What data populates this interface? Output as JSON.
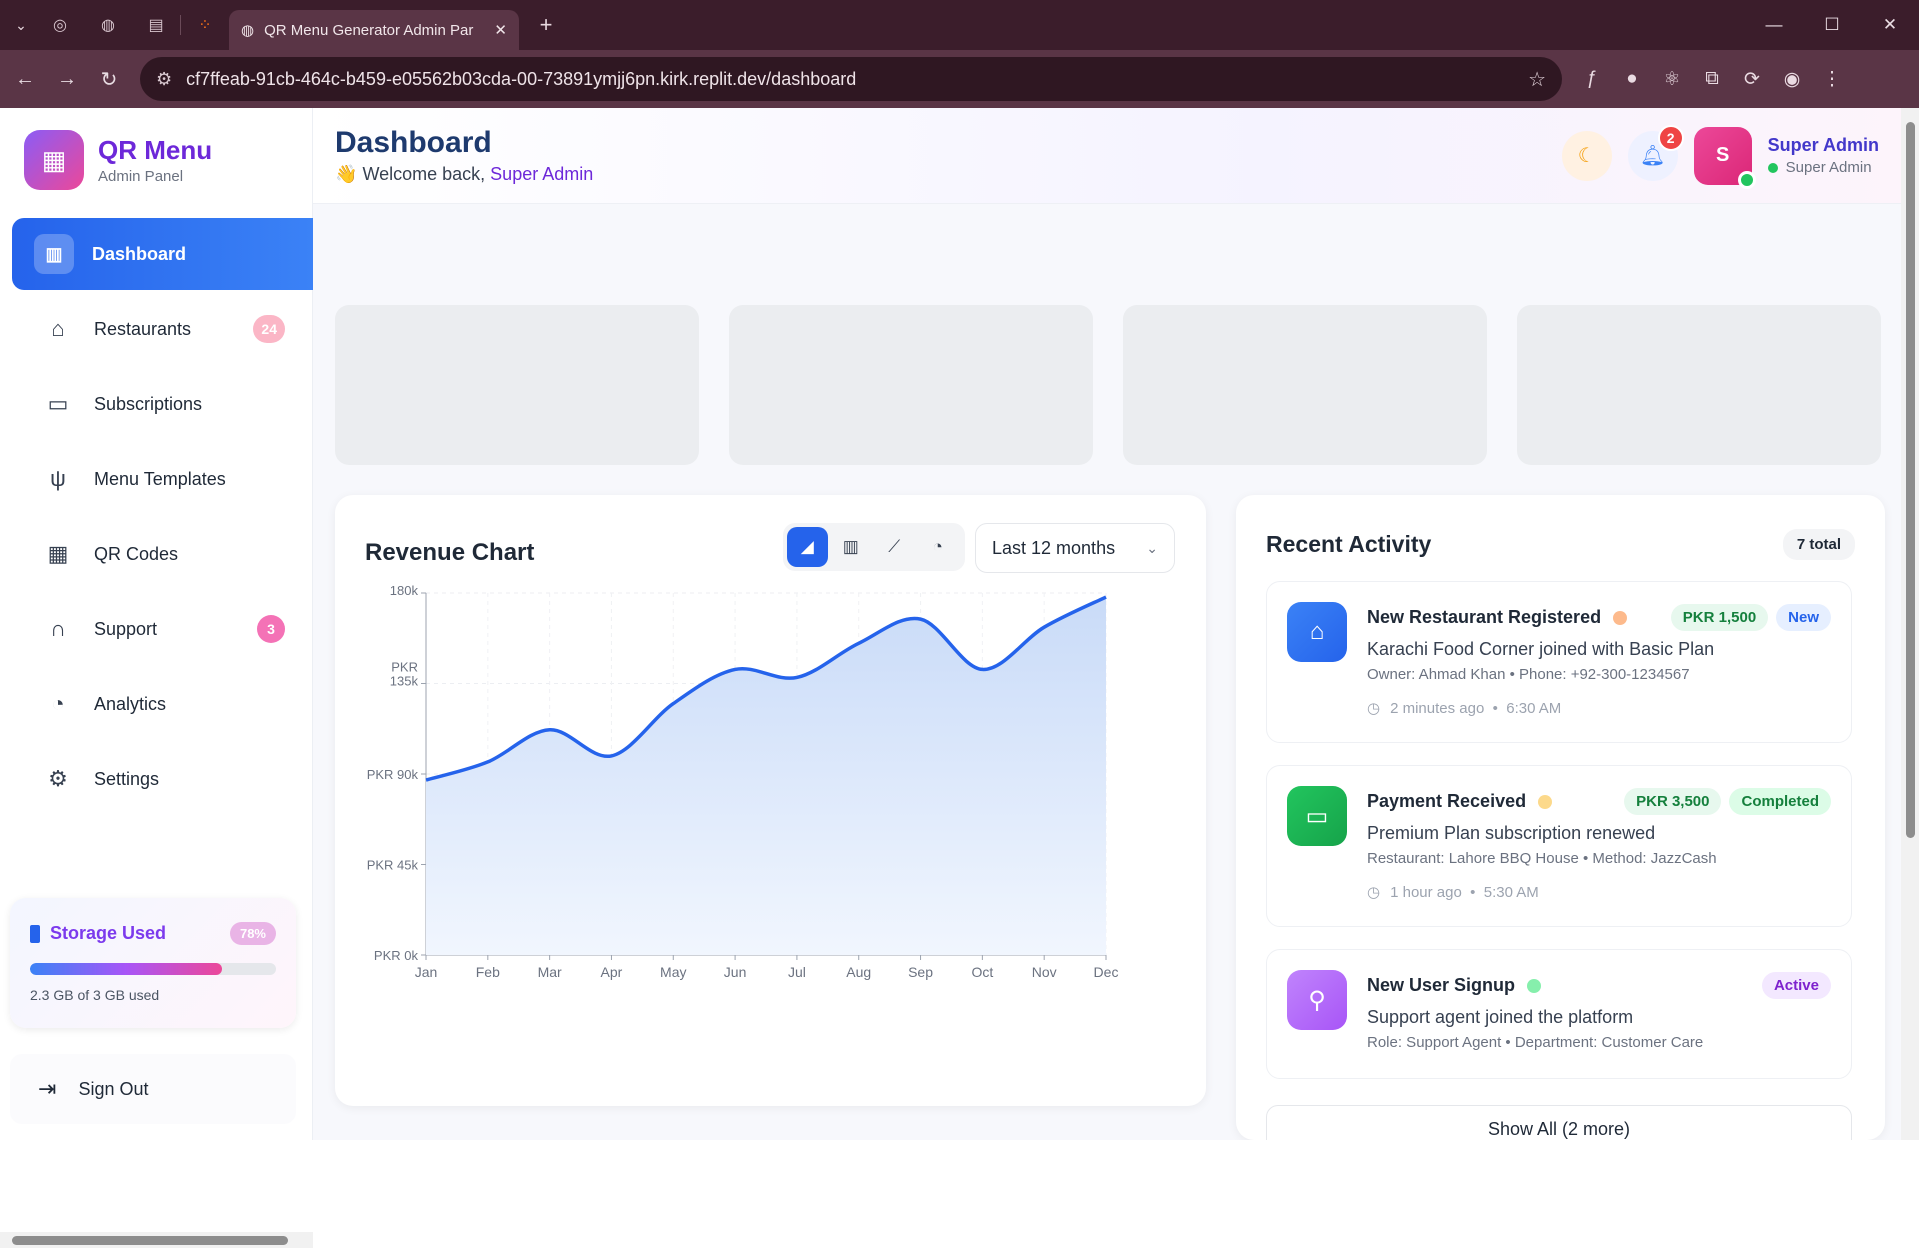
{
  "browser": {
    "tab_title": "QR Menu Generator Admin Par",
    "url": "cf7ffeab-91cb-464c-b459-e05562b03cda-00-73891ymjj6pn.kirk.replit.dev/dashboard"
  },
  "sidebar": {
    "brand_name": "QR Menu",
    "brand_sub": "Admin Panel",
    "items": [
      {
        "label": "Dashboard",
        "icon": "chart-icon",
        "active": true
      },
      {
        "label": "Restaurants",
        "icon": "store-icon",
        "badge": "24"
      },
      {
        "label": "Subscriptions",
        "icon": "card-icon"
      },
      {
        "label": "Menu Templates",
        "icon": "utensils-icon"
      },
      {
        "label": "QR Codes",
        "icon": "qr-icon"
      },
      {
        "label": "Support",
        "icon": "headphones-icon",
        "badge": "3"
      },
      {
        "label": "Analytics",
        "icon": "pie-icon"
      },
      {
        "label": "Settings",
        "icon": "gear-icon"
      }
    ],
    "storage": {
      "label": "Storage Used",
      "percent_text": "78%",
      "percent": 78,
      "detail": "2.3 GB of 3 GB used"
    },
    "signout": "Sign Out"
  },
  "header": {
    "title": "Dashboard",
    "welcome_prefix": "Welcome back,",
    "welcome_user": "Super Admin",
    "wave": "👋",
    "notif_count": "2",
    "avatar_letter": "S",
    "user_name": "Super Admin",
    "user_role": "Super Admin"
  },
  "chart": {
    "title": "Revenue Chart",
    "range_select": "Last 12 months"
  },
  "chart_data": {
    "type": "area",
    "title": "Revenue Chart",
    "x": [
      "Jan",
      "Feb",
      "Mar",
      "Apr",
      "May",
      "Jun",
      "Jul",
      "Aug",
      "Sep",
      "Oct",
      "Nov",
      "Dec"
    ],
    "series": [
      {
        "values": [
          87000,
          96000,
          112000,
          99000,
          125000,
          142000,
          138000,
          155000,
          167000,
          142000,
          163000,
          178000
        ]
      }
    ],
    "ylim": [
      0,
      180000
    ],
    "yticks": [
      0,
      45000,
      90000,
      135000,
      180000
    ],
    "ytick_labels": [
      "PKR 0k",
      "PKR 45k",
      "PKR 90k",
      "PKR 135k",
      "PKR 180k"
    ],
    "grid": true,
    "colors": {
      "line": "#2563eb",
      "fill": "#dbe7fb"
    }
  },
  "activity": {
    "title": "Recent Activity",
    "total": "7 total",
    "items": [
      {
        "title": "New Restaurant Registered",
        "dot": "#fdba8c",
        "amount": "PKR 1,500",
        "status": "New",
        "desc": "Karachi Food Corner joined with Basic Plan",
        "meta": "Owner: Ahmad Khan • Phone: +92-300-1234567",
        "time": "2 minutes ago",
        "clock": "6:30 AM",
        "icon_color": "#2563eb"
      },
      {
        "title": "Payment Received",
        "dot": "#fcd98b",
        "amount": "PKR 3,500",
        "status": "Completed",
        "desc": "Premium Plan subscription renewed",
        "meta": "Restaurant: Lahore BBQ House • Method: JazzCash",
        "time": "1 hour ago",
        "clock": "5:30 AM",
        "icon_color": "#16a34a"
      },
      {
        "title": "New User Signup",
        "dot": "#86efac",
        "status": "Active",
        "desc": "Support agent joined the platform",
        "meta": "Role: Support Agent • Department: Customer Care",
        "icon_color": "#a855f7"
      }
    ],
    "show_all": "Show All (2 more)"
  }
}
